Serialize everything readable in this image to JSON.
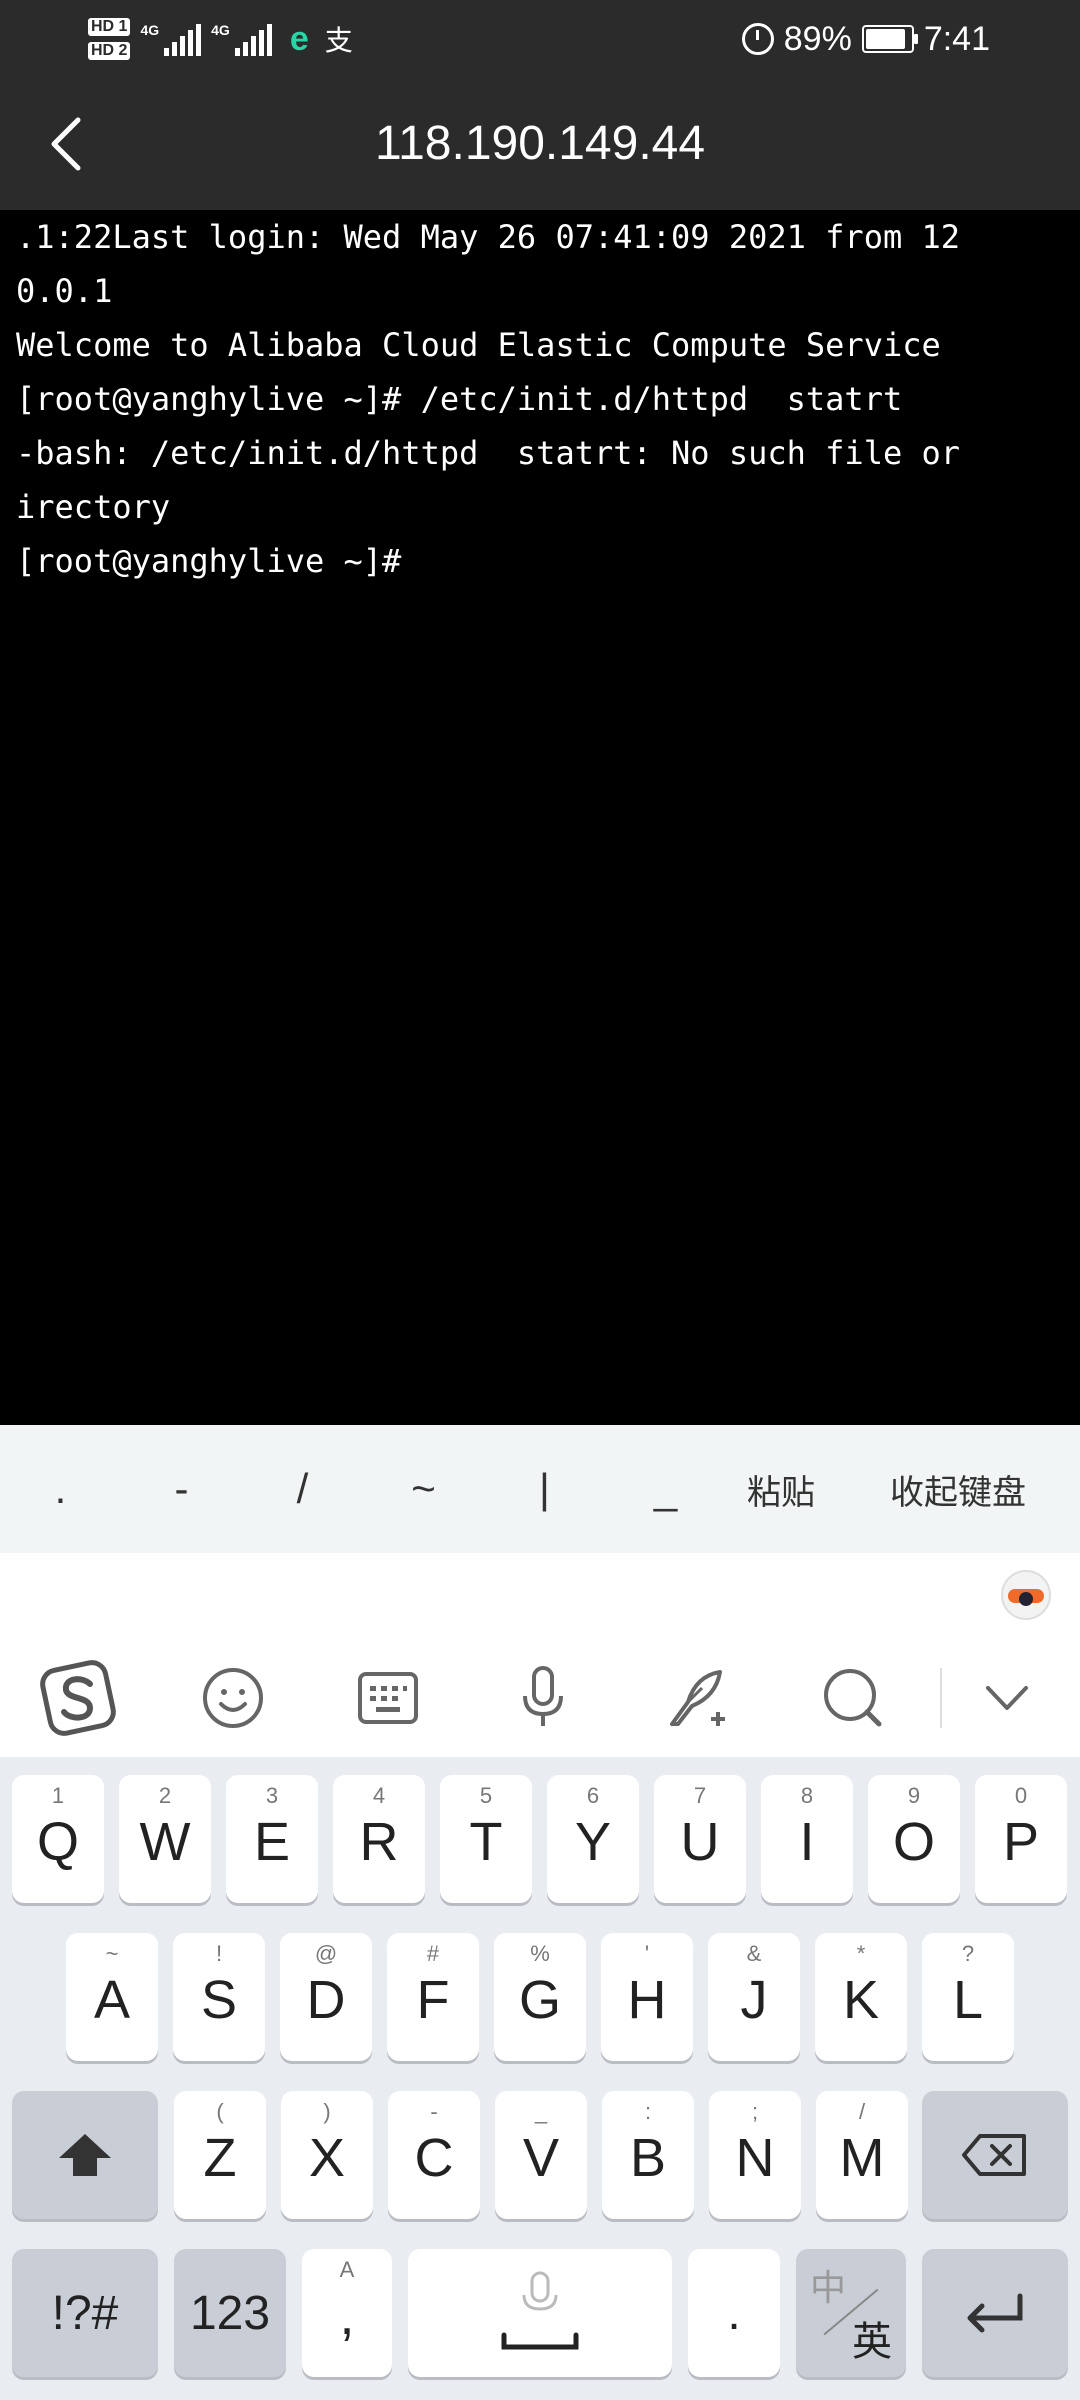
{
  "status_bar": {
    "hd1": "HD 1",
    "hd2": "HD 2",
    "net1": "4G",
    "net2": "4G",
    "battery_pct": "89%",
    "time": "7:41",
    "battery_level": 0.89
  },
  "header": {
    "title": "118.190.149.44"
  },
  "terminal": {
    "lines": [
      ".1:22Last login: Wed May 26 07:41:09 2021 from 12",
      "0.0.1",
      "",
      "Welcome to Alibaba Cloud Elastic Compute Service",
      "",
      "[root@yanghylive ~]# /etc/init.d/httpd  statrt",
      "-bash: /etc/init.d/httpd  statrt: No such file or",
      "irectory",
      "[root@yanghylive ~]#"
    ]
  },
  "shortcuts": [
    ".",
    "-",
    "/",
    "~",
    "|",
    "_",
    "粘贴",
    "收起键盘"
  ],
  "keyboard": {
    "row1": [
      {
        "main": "Q",
        "sub": "1"
      },
      {
        "main": "W",
        "sub": "2"
      },
      {
        "main": "E",
        "sub": "3"
      },
      {
        "main": "R",
        "sub": "4"
      },
      {
        "main": "T",
        "sub": "5"
      },
      {
        "main": "Y",
        "sub": "6"
      },
      {
        "main": "U",
        "sub": "7"
      },
      {
        "main": "I",
        "sub": "8"
      },
      {
        "main": "O",
        "sub": "9"
      },
      {
        "main": "P",
        "sub": "0"
      }
    ],
    "row2": [
      {
        "main": "A",
        "sub": "~"
      },
      {
        "main": "S",
        "sub": "!"
      },
      {
        "main": "D",
        "sub": "@"
      },
      {
        "main": "F",
        "sub": "#"
      },
      {
        "main": "G",
        "sub": "%"
      },
      {
        "main": "H",
        "sub": "'"
      },
      {
        "main": "J",
        "sub": "&"
      },
      {
        "main": "K",
        "sub": "*"
      },
      {
        "main": "L",
        "sub": "?"
      }
    ],
    "row3": [
      {
        "main": "Z",
        "sub": "("
      },
      {
        "main": "X",
        "sub": ")"
      },
      {
        "main": "C",
        "sub": "-"
      },
      {
        "main": "V",
        "sub": "_"
      },
      {
        "main": "B",
        "sub": ":"
      },
      {
        "main": "N",
        "sub": ";"
      },
      {
        "main": "M",
        "sub": "/"
      }
    ],
    "symbols_label": "!?#",
    "numbers_label": "123",
    "comma_label": ",",
    "comma_sub": "A",
    "period_label": ".",
    "lang_label_top": "中",
    "lang_label_bottom": "英"
  }
}
